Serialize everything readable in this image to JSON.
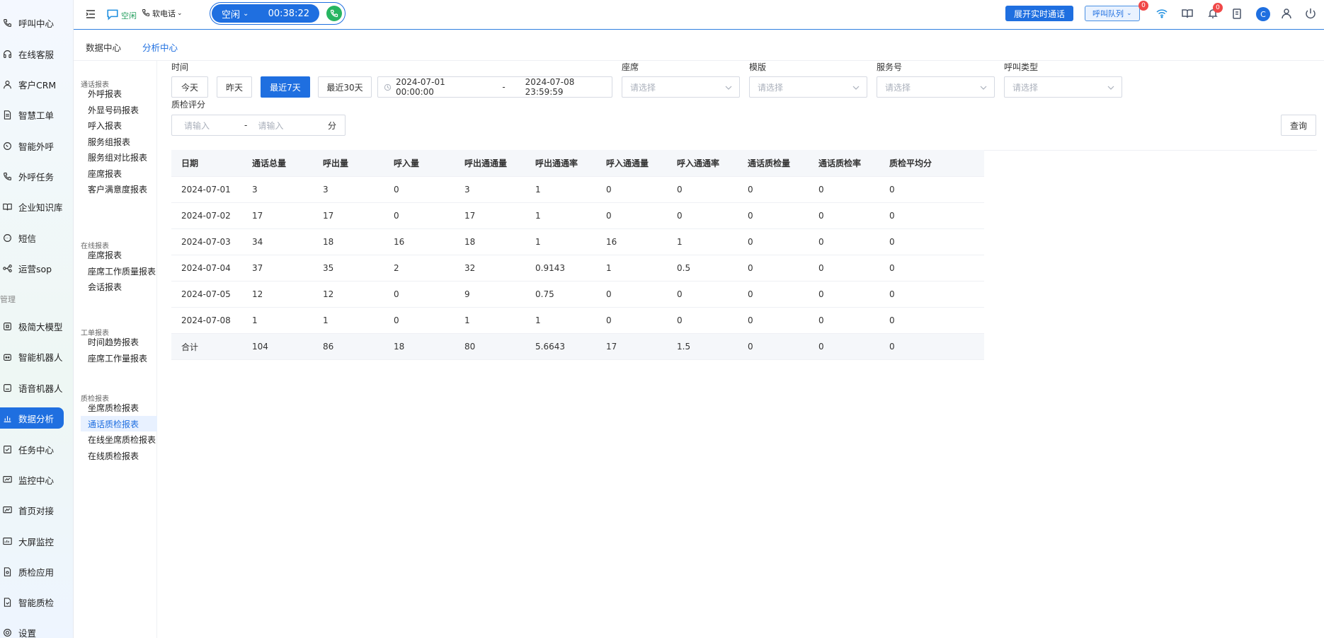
{
  "sidebar": {
    "items": [
      {
        "label": "呼叫中心",
        "icon": "phone-icon"
      },
      {
        "label": "在线客服",
        "icon": "headset-icon"
      },
      {
        "label": "客户CRM",
        "icon": "user-icon"
      },
      {
        "label": "智慧工单",
        "icon": "document-icon"
      },
      {
        "label": "智能外呼",
        "icon": "chat-phone-icon"
      },
      {
        "label": "外呼任务",
        "icon": "phone-task-icon"
      },
      {
        "label": "企业知识库",
        "icon": "book-icon"
      },
      {
        "label": "短信",
        "icon": "message-icon"
      },
      {
        "label": "运营sop",
        "icon": "flow-icon"
      }
    ],
    "group_label": "管理",
    "items2": [
      {
        "label": "极简大模型",
        "icon": "model-icon"
      },
      {
        "label": "智能机器人",
        "icon": "robot-icon"
      },
      {
        "label": "语音机器人",
        "icon": "voice-robot-icon"
      },
      {
        "label": "数据分析",
        "icon": "bar-chart-icon"
      },
      {
        "label": "任务中心",
        "icon": "checklist-icon"
      },
      {
        "label": "监控中心",
        "icon": "monitor-icon"
      },
      {
        "label": "首页对接",
        "icon": "dashboard-icon"
      },
      {
        "label": "大屏监控",
        "icon": "screen-icon"
      },
      {
        "label": "质检应用",
        "icon": "inspect-icon"
      },
      {
        "label": "智能质检",
        "icon": "smart-inspect-icon"
      },
      {
        "label": "设置",
        "icon": "settings-icon"
      }
    ]
  },
  "topbar": {
    "status_label": "空闲",
    "softphone_label": "软电话",
    "call_status": "空闲",
    "call_timer": "00:38:22",
    "live_button": "展开实时通话",
    "queue_button": "呼叫队列",
    "queue_badge": "0",
    "notif_badge": "0",
    "avatar_letter": "C"
  },
  "tabs": [
    "数据中心",
    "分析中心"
  ],
  "report_nav": {
    "groups": [
      {
        "title": "通话报表",
        "items": [
          "外呼报表",
          "外显号码报表",
          "呼入报表",
          "服务组报表",
          "服务组对比报表",
          "座席报表",
          "客户满意度报表"
        ]
      },
      {
        "title": "在线报表",
        "items": [
          "座席报表",
          "座席工作质量报表",
          "会话报表"
        ]
      },
      {
        "title": "工单报表",
        "items": [
          "时间趋势报表",
          "座席工作量报表"
        ]
      },
      {
        "title": "质检报表",
        "items": [
          "坐席质检报表",
          "通话质检报表",
          "在线坐席质检报表",
          "在线质检报表"
        ]
      }
    ],
    "active": "通话质检报表"
  },
  "filters": {
    "time_label": "时间",
    "btn_today": "今天",
    "btn_yesterday": "昨天",
    "btn_7days": "最近7天",
    "btn_30days": "最近30天",
    "date_start": "2024-07-01 00:00:00",
    "date_sep": "-",
    "date_end": "2024-07-08 23:59:59",
    "agent_label": "座席",
    "template_label": "模版",
    "service_label": "服务号",
    "calltype_label": "呼叫类型",
    "select_placeholder": "请选择",
    "score_label": "质检评分",
    "score_placeholder": "请输入",
    "score_sep": "-",
    "score_unit": "分",
    "query_button": "查询"
  },
  "table": {
    "headers": [
      "日期",
      "通话总量",
      "呼出量",
      "呼入量",
      "呼出通通量",
      "呼出通通率",
      "呼入通通量",
      "呼入通通率",
      "通话质检量",
      "通话质检率",
      "质检平均分"
    ],
    "rows": [
      [
        "2024-07-01",
        "3",
        "3",
        "0",
        "3",
        "1",
        "0",
        "0",
        "0",
        "0",
        "0"
      ],
      [
        "2024-07-02",
        "17",
        "17",
        "0",
        "17",
        "1",
        "0",
        "0",
        "0",
        "0",
        "0"
      ],
      [
        "2024-07-03",
        "34",
        "18",
        "16",
        "18",
        "1",
        "16",
        "1",
        "0",
        "0",
        "0"
      ],
      [
        "2024-07-04",
        "37",
        "35",
        "2",
        "32",
        "0.9143",
        "1",
        "0.5",
        "0",
        "0",
        "0"
      ],
      [
        "2024-07-05",
        "12",
        "12",
        "0",
        "9",
        "0.75",
        "0",
        "0",
        "0",
        "0",
        "0"
      ],
      [
        "2024-07-08",
        "1",
        "1",
        "0",
        "1",
        "1",
        "0",
        "0",
        "0",
        "0",
        "0"
      ]
    ],
    "total": [
      "合计",
      "104",
      "86",
      "18",
      "80",
      "5.6643",
      "17",
      "1.5",
      "0",
      "0",
      "0"
    ]
  }
}
